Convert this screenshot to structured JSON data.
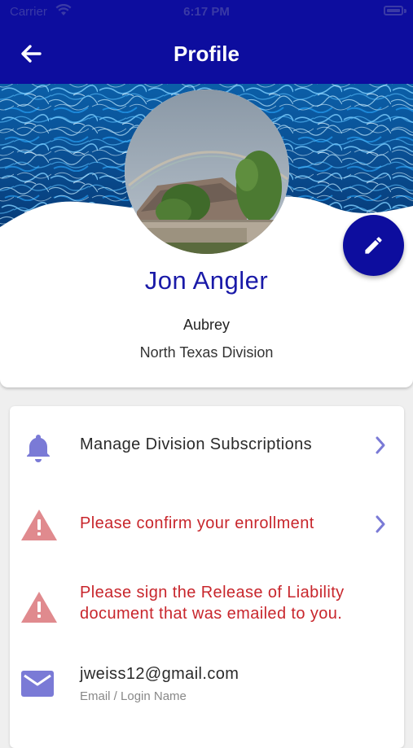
{
  "status_bar": {
    "carrier": "Carrier",
    "time": "6:17 PM"
  },
  "header": {
    "title": "Profile"
  },
  "profile": {
    "name": "Jon Angler",
    "city": "Aubrey",
    "division": "North Texas Division"
  },
  "menu": {
    "subscriptions_label": "Manage Division Subscriptions",
    "enrollment_label": "Please confirm your enrollment",
    "release_line1": "Please sign the Release of Liability",
    "release_line2": "document that was emailed to you.",
    "email_value": "jweiss12@gmail.com",
    "email_caption": "Email / Login Name"
  },
  "colors": {
    "primary": "#0d0d9e",
    "accent_icon": "#7a7ad6",
    "warning_icon": "#e08a8e",
    "warning_text": "#c8262c"
  },
  "icons": {
    "back": "arrow-left-icon",
    "edit": "pencil-icon",
    "bell": "bell-icon",
    "warning": "warning-triangle-icon",
    "chevron": "chevron-right-icon",
    "email": "envelope-icon"
  }
}
